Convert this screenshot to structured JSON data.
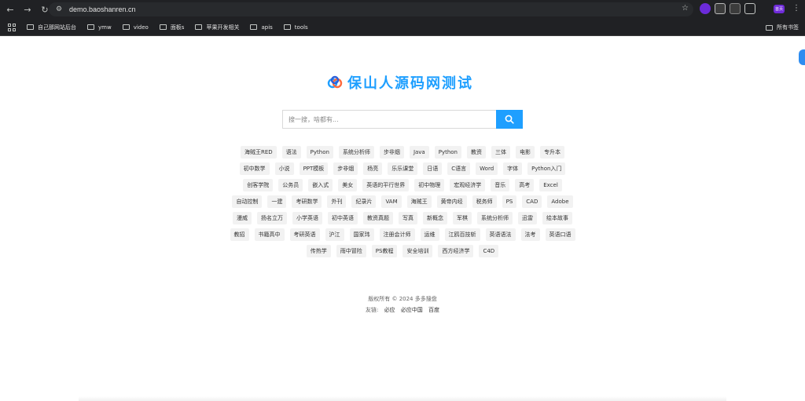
{
  "browser": {
    "url": "demo.baoshanren.cn",
    "profile_label": "首页",
    "bookmarks": [
      "自己那网站后台",
      "ymw",
      "video",
      "面板s",
      "苹果开发相关",
      "apis",
      "tools"
    ],
    "bookmarks_right": "所有书签"
  },
  "site": {
    "title": "保山人源码网测试",
    "accent": "#1e9fff",
    "search_placeholder": "搜一搜，啥都有..."
  },
  "tags": [
    "海贼王RED",
    "语法",
    "Python",
    "系统分析师",
    "步非烟",
    "Java",
    "Python",
    "教资",
    "三体",
    "电影",
    "专升本",
    "初中数学",
    "小说",
    "PPT模板",
    "步非烟",
    "杨亮",
    "乐乐课堂",
    "日语",
    "C语言",
    "Word",
    "字体",
    "Python入门",
    "创客学院",
    "公务员",
    "嵌入式",
    "美女",
    "英语的平行世界",
    "初中物理",
    "宏观经济学",
    "音乐",
    "高考",
    "Excel",
    "自动控制",
    "一建",
    "考研数学",
    "外刊",
    "纪录片",
    "VAM",
    "海贼王",
    "黄帝内经",
    "税务师",
    "PS",
    "CAD",
    "Adobe",
    "漫威",
    "扬名立万",
    "小学英语",
    "初中英语",
    "教资真题",
    "写真",
    "新概念",
    "军棋",
    "系统分析师",
    "迅雷",
    "绘本故事",
    "教招",
    "书籍高中",
    "考研英语",
    "沪江",
    "国家玮",
    "注册会计师",
    "运维",
    "江鸥百技斩",
    "英语语法",
    "法考",
    "英语口语",
    "传热学",
    "雨中冒险",
    "PS教程",
    "安全培训",
    "西方经济学",
    "C4D"
  ],
  "footer": {
    "copyright": "版权所有 © 2024 多多搜盘",
    "links_label": "友链:",
    "links": [
      "必应",
      "必应中国",
      "百度"
    ]
  }
}
